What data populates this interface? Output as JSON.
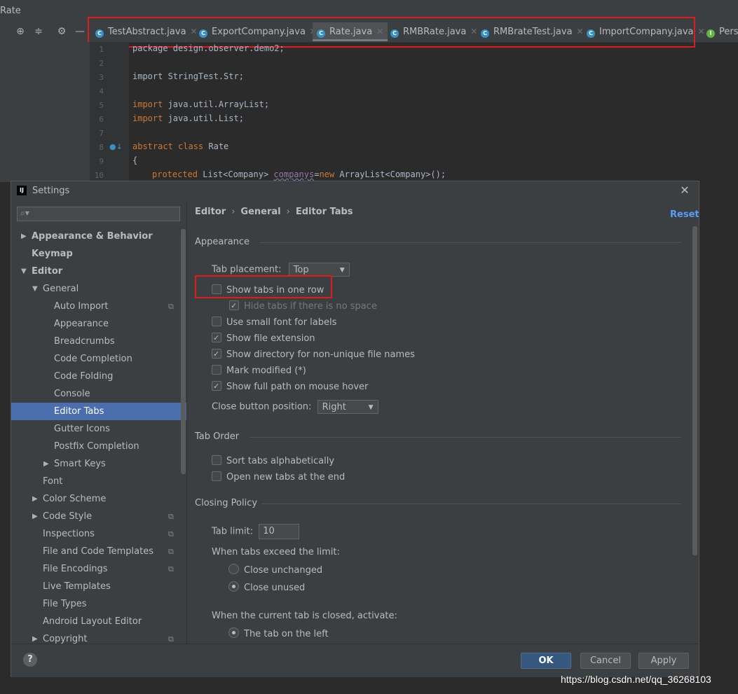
{
  "window": {
    "title": "Rate"
  },
  "editor_tabs": [
    {
      "label": "TestAbstract.java",
      "icon": "class-icon"
    },
    {
      "label": "ExportCompany.java",
      "icon": "class-icon"
    },
    {
      "label": "Rate.java",
      "icon": "abstract-class-icon",
      "active": true
    },
    {
      "label": "RMBRate.java",
      "icon": "class-icon"
    },
    {
      "label": "RMBrateTest.java",
      "icon": "test-class-icon"
    },
    {
      "label": "ImportCompany.java",
      "icon": "class-icon"
    },
    {
      "label": "Pers",
      "icon": "interface-icon"
    }
  ],
  "code": {
    "line_numbers": [
      "1",
      "2",
      "3",
      "4",
      "5",
      "6",
      "7",
      "8",
      "9",
      "10"
    ],
    "l1": "package design.observer.demo2;",
    "l3": "import StringTest.Str;",
    "l5_kw": "import",
    "l5_rest": " java.util.ArrayList;",
    "l6_kw": "import",
    "l6_rest": " java.util.List;",
    "l8_kw": "abstract class",
    "l8_rest": " Rate",
    "l9": "{",
    "l10_kw1": "protected",
    "l10_a": " List<Company> ",
    "l10_field": "companys",
    "l10_b": "=",
    "l10_kw2": "new",
    "l10_c": " ArrayList<Company>();"
  },
  "dialog": {
    "title": "Settings",
    "search_placeholder": "",
    "breadcrumb": [
      "Editor",
      "General",
      "Editor Tabs"
    ],
    "reset_label": "Reset",
    "tree": [
      {
        "label": "Appearance & Behavior",
        "level": 0,
        "arrow": "right",
        "bold": true
      },
      {
        "label": "Keymap",
        "level": 0,
        "bold": true
      },
      {
        "label": "Editor",
        "level": 0,
        "arrow": "down",
        "bold": true
      },
      {
        "label": "General",
        "level": 1,
        "arrow": "down"
      },
      {
        "label": "Auto Import",
        "level": 2,
        "copy": true
      },
      {
        "label": "Appearance",
        "level": 2
      },
      {
        "label": "Breadcrumbs",
        "level": 2
      },
      {
        "label": "Code Completion",
        "level": 2
      },
      {
        "label": "Code Folding",
        "level": 2
      },
      {
        "label": "Console",
        "level": 2
      },
      {
        "label": "Editor Tabs",
        "level": 2,
        "selected": true
      },
      {
        "label": "Gutter Icons",
        "level": 2
      },
      {
        "label": "Postfix Completion",
        "level": 2
      },
      {
        "label": "Smart Keys",
        "level": 2,
        "arrow": "right"
      },
      {
        "label": "Font",
        "level": 1
      },
      {
        "label": "Color Scheme",
        "level": 1,
        "arrow": "right"
      },
      {
        "label": "Code Style",
        "level": 1,
        "arrow": "right",
        "copy": true
      },
      {
        "label": "Inspections",
        "level": 1,
        "copy": true
      },
      {
        "label": "File and Code Templates",
        "level": 1,
        "copy": true
      },
      {
        "label": "File Encodings",
        "level": 1,
        "copy": true
      },
      {
        "label": "Live Templates",
        "level": 1
      },
      {
        "label": "File Types",
        "level": 1
      },
      {
        "label": "Android Layout Editor",
        "level": 1
      },
      {
        "label": "Copyright",
        "level": 1,
        "arrow": "right",
        "copy": true
      }
    ],
    "appearance": {
      "section_title": "Appearance",
      "tab_placement_label": "Tab placement:",
      "tab_placement_value": "Top",
      "show_tabs_one_row": "Show tabs in one row",
      "hide_tabs_no_space": "Hide tabs if there is no space",
      "use_small_font": "Use small font for labels",
      "show_file_extension": "Show file extension",
      "show_directory": "Show directory for non-unique file names",
      "mark_modified": "Mark modified (*)",
      "show_full_path": "Show full path on mouse hover",
      "close_button_label": "Close button position:",
      "close_button_value": "Right"
    },
    "tab_order": {
      "section_title": "Tab Order",
      "sort_alpha": "Sort tabs alphabetically",
      "open_at_end": "Open new tabs at the end"
    },
    "closing_policy": {
      "section_title": "Closing Policy",
      "tab_limit_label": "Tab limit:",
      "tab_limit_value": "10",
      "exceed_label": "When tabs exceed the limit:",
      "close_unchanged": "Close unchanged",
      "close_unused": "Close unused",
      "activate_label": "When the current tab is closed, activate:",
      "tab_on_left": "The tab on the left"
    },
    "buttons": {
      "ok": "OK",
      "cancel": "Cancel",
      "apply": "Apply",
      "help": "?"
    }
  },
  "watermark": "https://blog.csdn.net/qq_36268103"
}
